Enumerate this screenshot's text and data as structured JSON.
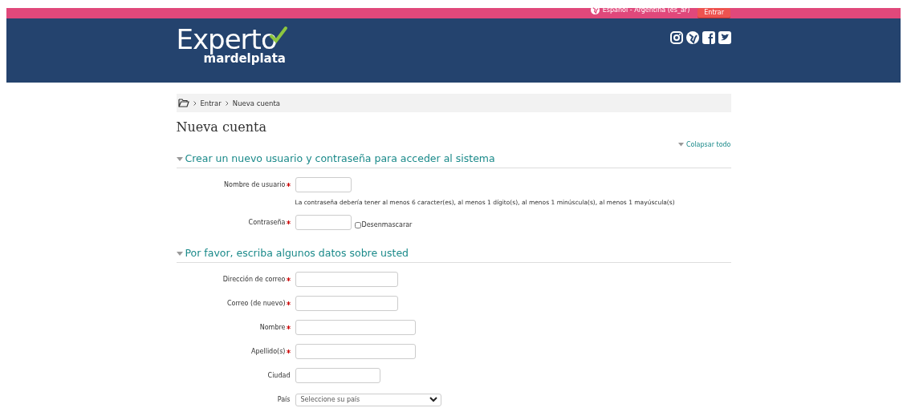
{
  "topbar": {
    "language": "Español - Argentina (es_ar)",
    "login_button": "Entrar"
  },
  "header": {
    "logo_title": "Experto",
    "logo_subtitle": "mardelplata"
  },
  "breadcrumb": [
    "Entrar",
    "Nueva cuenta"
  ],
  "page_title": "Nueva cuenta",
  "collapse_all": "Colapsar todo",
  "sections": [
    {
      "title": "Crear un nuevo usuario y contraseña para acceder al sistema",
      "expanded": true,
      "fields": [
        {
          "kind": "text",
          "label": "Nombre de usuario",
          "required": true
        },
        {
          "kind": "note",
          "text": "La contraseña debería tener al menos 6 caracter(es), al menos 1 dígito(s), al menos 1 minúscula(s), al menos 1 mayúscula(s)"
        },
        {
          "kind": "password",
          "label": "Contraseña",
          "required": true,
          "unmask_label": "Desenmascarar",
          "unmask_checked": false
        }
      ]
    },
    {
      "title": "Por favor, escriba algunos datos sobre usted",
      "expanded": true,
      "fields": [
        {
          "kind": "text",
          "label": "Dirección de correo",
          "required": true
        },
        {
          "kind": "text",
          "label": "Correo (de nuevo)",
          "required": true
        },
        {
          "kind": "text",
          "label": "Nombre",
          "required": true
        },
        {
          "kind": "text",
          "label": "Apellido(s)",
          "required": true
        },
        {
          "kind": "text",
          "label": "Ciudad",
          "required": false
        },
        {
          "kind": "select",
          "label": "País",
          "required": false,
          "value": "Seleccione su país"
        }
      ]
    }
  ]
}
